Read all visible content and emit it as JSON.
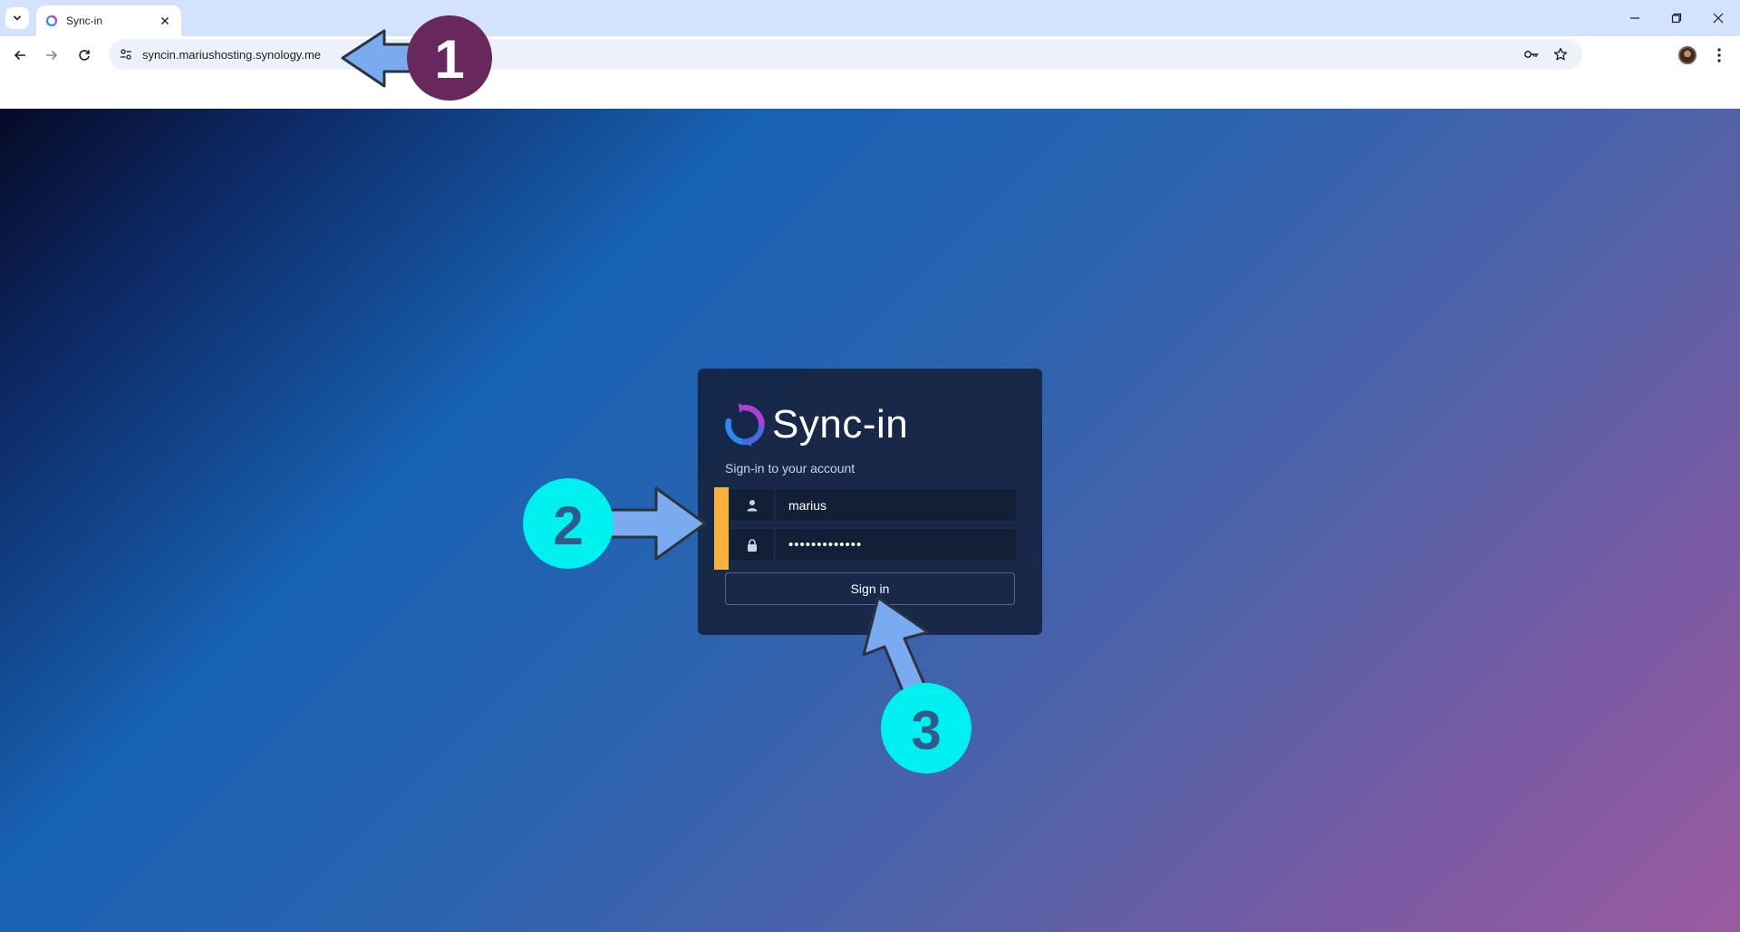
{
  "browser": {
    "tab": {
      "title": "Sync-in"
    },
    "url": "syncin.mariushosting.synology.me"
  },
  "login": {
    "brand": "Sync-in",
    "subtitle": "Sign-in to your account",
    "username_value": "marius",
    "password_value": "•••••••••••••",
    "submit_label": "Sign in"
  },
  "annotations": {
    "step1": "1",
    "step2": "2",
    "step3": "3"
  },
  "colors": {
    "step1_badge": "#68285e",
    "step2_badge": "#00f0f0",
    "step3_badge": "#00f0f0",
    "step_number_dark": "#2e5a8c",
    "arrow_fill": "#7aaaf0",
    "accent_bar": "#f6b13b"
  }
}
